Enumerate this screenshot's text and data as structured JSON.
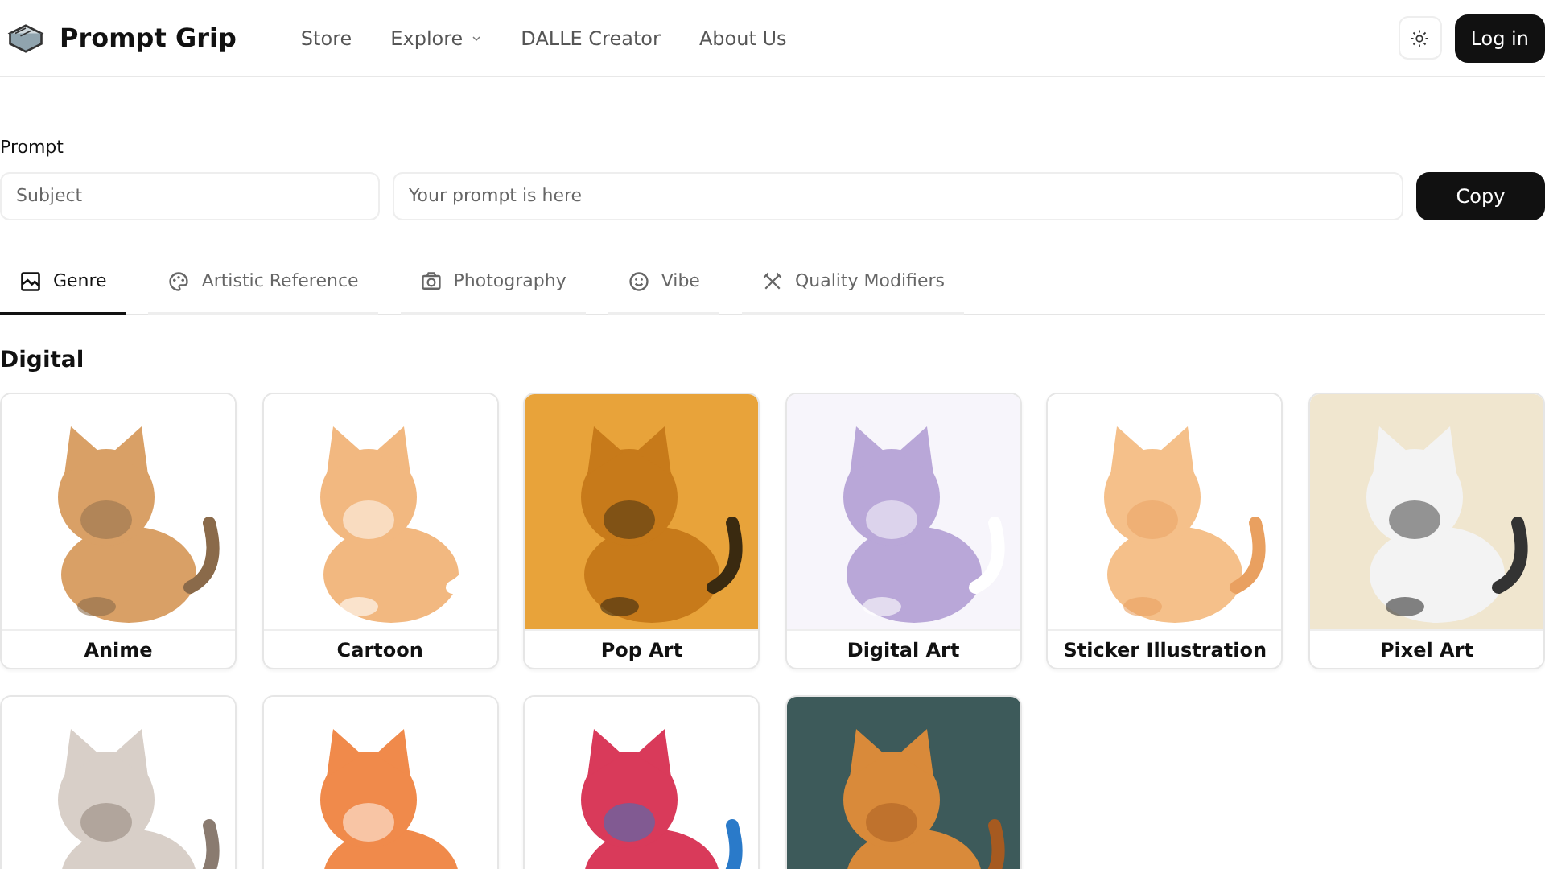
{
  "brand": {
    "name": "Prompt Grip"
  },
  "nav": [
    {
      "label": "Store",
      "dropdown": false
    },
    {
      "label": "Explore",
      "dropdown": true
    },
    {
      "label": "DALLE Creator",
      "dropdown": false
    },
    {
      "label": "About Us",
      "dropdown": false
    }
  ],
  "login_button": "Log in",
  "prompt": {
    "label": "Prompt",
    "subject_placeholder": "Subject",
    "prompt_placeholder": "Your prompt is here",
    "copy_button": "Copy"
  },
  "tabs": [
    {
      "label": "Genre",
      "selected": true
    },
    {
      "label": "Artistic Reference",
      "selected": false
    },
    {
      "label": "Photography",
      "selected": false
    },
    {
      "label": "Vibe",
      "selected": false
    },
    {
      "label": "Quality Modifiers",
      "selected": false
    }
  ],
  "section": {
    "title": "Digital",
    "cards": [
      {
        "kind": "picture",
        "label": "Anime"
      },
      {
        "kind": "picture",
        "label": "Cartoon"
      },
      {
        "kind": "picture",
        "label": "Pop Art"
      },
      {
        "kind": "picture",
        "label": "Digital Art"
      },
      {
        "kind": "picture",
        "label": "Sticker Illustration"
      },
      {
        "kind": "picture",
        "label": "Pixel Art"
      },
      {
        "kind": "picture"
      },
      {
        "kind": "picture"
      },
      {
        "kind": "picture"
      },
      {
        "kind": "picture"
      }
    ]
  }
}
